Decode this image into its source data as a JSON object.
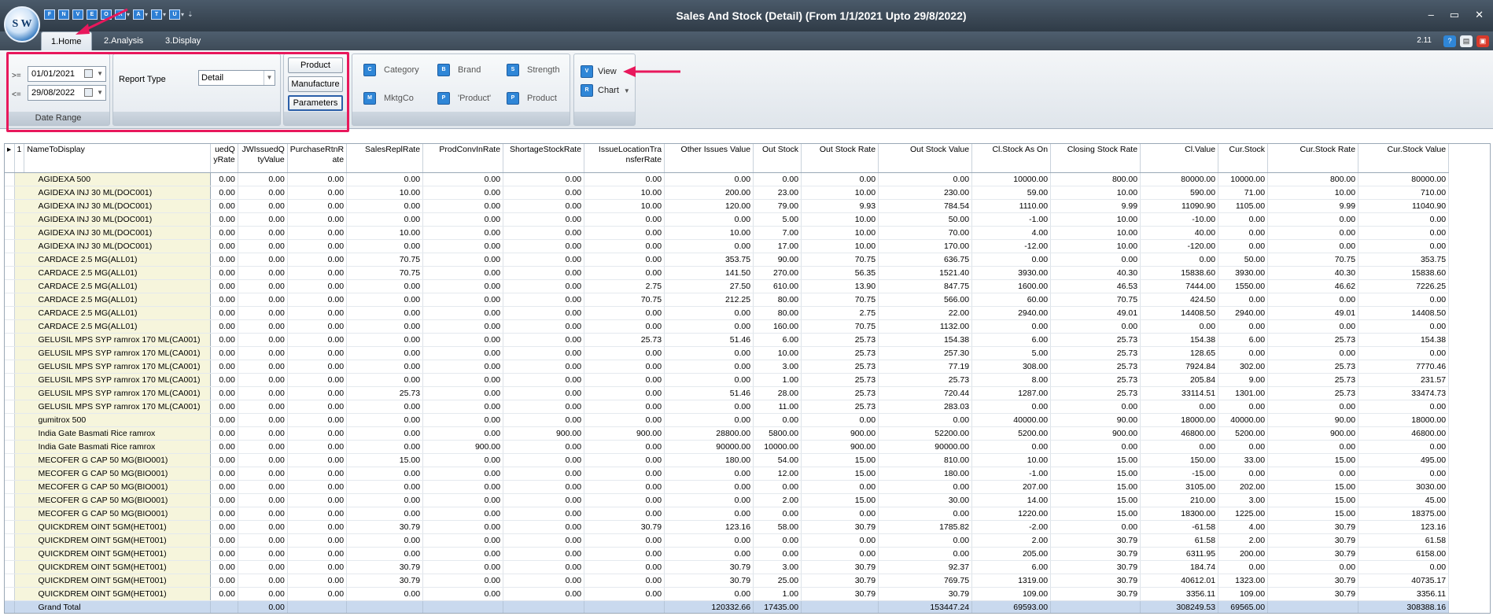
{
  "window": {
    "title": "Sales And Stock (Detail)  (From 1/1/2021 Upto 29/8/2022)",
    "logo_text": "S W",
    "version": "2.11"
  },
  "qat_buttons": [
    "F",
    "N",
    "V",
    "E",
    "O",
    "R",
    "A",
    "T",
    "U"
  ],
  "tabs": [
    {
      "label": "1.Home",
      "active": true
    },
    {
      "label": "2.Analysis",
      "active": false
    },
    {
      "label": "3.Display",
      "active": false
    }
  ],
  "ribbon": {
    "date_range": {
      "from_label": ">=",
      "from_value": "01/01/2021",
      "to_label": "<=",
      "to_value": "29/08/2022",
      "caption": "Date Range"
    },
    "report_type": {
      "label": "Report Type",
      "value": "Detail"
    },
    "buttons": {
      "product": "Product",
      "manufacture": "Manufacture",
      "parameters": "Parameters"
    },
    "filters": [
      {
        "label": "Category",
        "icon": "category-icon"
      },
      {
        "label": "Brand",
        "icon": "brand-icon"
      },
      {
        "label": "Strength",
        "icon": "strength-icon"
      },
      {
        "label": "MktgCo",
        "icon": "mktgco-icon"
      },
      {
        "label": "'Product'",
        "icon": "product-filter-icon"
      },
      {
        "label": "Product",
        "icon": "product-icon"
      }
    ],
    "view_label": "View",
    "chart_label": "Chart"
  },
  "grid": {
    "row_indicator": "1",
    "columns": [
      "NameToDisplay",
      "uedQ yRate",
      "JWIssuedQ tyValue",
      "PurchaseRtnR ate",
      "SalesReplRate",
      "ProdConvInRate",
      "ShortageStockRate",
      "IssueLocationTra nsferRate",
      "Other Issues Value",
      "Out Stock",
      "Out Stock Rate",
      "Out Stock Value",
      "Cl.Stock As On",
      "Closing Stock Rate",
      "Cl.Value",
      "Cur.Stock",
      "Cur.Stock Rate",
      "Cur.Stock Value"
    ],
    "rows": [
      [
        "AGIDEXA 500",
        "0.00",
        "0.00",
        "0.00",
        "0.00",
        "0.00",
        "0.00",
        "0.00",
        "0.00",
        "0.00",
        "0.00",
        "0.00",
        "10000.00",
        "800.00",
        "80000.00",
        "10000.00",
        "800.00",
        "80000.00"
      ],
      [
        "AGIDEXA INJ 30 ML(DOC001)",
        "0.00",
        "0.00",
        "0.00",
        "10.00",
        "0.00",
        "0.00",
        "10.00",
        "200.00",
        "23.00",
        "10.00",
        "230.00",
        "59.00",
        "10.00",
        "590.00",
        "71.00",
        "10.00",
        "710.00"
      ],
      [
        "AGIDEXA INJ 30 ML(DOC001)",
        "0.00",
        "0.00",
        "0.00",
        "0.00",
        "0.00",
        "0.00",
        "10.00",
        "120.00",
        "79.00",
        "9.93",
        "784.54",
        "1110.00",
        "9.99",
        "11090.90",
        "1105.00",
        "9.99",
        "11040.90"
      ],
      [
        "AGIDEXA INJ 30 ML(DOC001)",
        "0.00",
        "0.00",
        "0.00",
        "0.00",
        "0.00",
        "0.00",
        "0.00",
        "0.00",
        "5.00",
        "10.00",
        "50.00",
        "-1.00",
        "10.00",
        "-10.00",
        "0.00",
        "0.00",
        "0.00"
      ],
      [
        "AGIDEXA INJ 30 ML(DOC001)",
        "0.00",
        "0.00",
        "0.00",
        "10.00",
        "0.00",
        "0.00",
        "0.00",
        "10.00",
        "7.00",
        "10.00",
        "70.00",
        "4.00",
        "10.00",
        "40.00",
        "0.00",
        "0.00",
        "0.00"
      ],
      [
        "AGIDEXA INJ 30 ML(DOC001)",
        "0.00",
        "0.00",
        "0.00",
        "0.00",
        "0.00",
        "0.00",
        "0.00",
        "0.00",
        "17.00",
        "10.00",
        "170.00",
        "-12.00",
        "10.00",
        "-120.00",
        "0.00",
        "0.00",
        "0.00"
      ],
      [
        "CARDACE 2.5 MG(ALL01)",
        "0.00",
        "0.00",
        "0.00",
        "70.75",
        "0.00",
        "0.00",
        "0.00",
        "353.75",
        "90.00",
        "70.75",
        "636.75",
        "0.00",
        "0.00",
        "0.00",
        "50.00",
        "70.75",
        "353.75"
      ],
      [
        "CARDACE 2.5 MG(ALL01)",
        "0.00",
        "0.00",
        "0.00",
        "70.75",
        "0.00",
        "0.00",
        "0.00",
        "141.50",
        "270.00",
        "56.35",
        "1521.40",
        "3930.00",
        "40.30",
        "15838.60",
        "3930.00",
        "40.30",
        "15838.60"
      ],
      [
        "CARDACE 2.5 MG(ALL01)",
        "0.00",
        "0.00",
        "0.00",
        "0.00",
        "0.00",
        "0.00",
        "2.75",
        "27.50",
        "610.00",
        "13.90",
        "847.75",
        "1600.00",
        "46.53",
        "7444.00",
        "1550.00",
        "46.62",
        "7226.25"
      ],
      [
        "CARDACE 2.5 MG(ALL01)",
        "0.00",
        "0.00",
        "0.00",
        "0.00",
        "0.00",
        "0.00",
        "70.75",
        "212.25",
        "80.00",
        "70.75",
        "566.00",
        "60.00",
        "70.75",
        "424.50",
        "0.00",
        "0.00",
        "0.00"
      ],
      [
        "CARDACE 2.5 MG(ALL01)",
        "0.00",
        "0.00",
        "0.00",
        "0.00",
        "0.00",
        "0.00",
        "0.00",
        "0.00",
        "80.00",
        "2.75",
        "22.00",
        "2940.00",
        "49.01",
        "14408.50",
        "2940.00",
        "49.01",
        "14408.50"
      ],
      [
        "CARDACE 2.5 MG(ALL01)",
        "0.00",
        "0.00",
        "0.00",
        "0.00",
        "0.00",
        "0.00",
        "0.00",
        "0.00",
        "160.00",
        "70.75",
        "1132.00",
        "0.00",
        "0.00",
        "0.00",
        "0.00",
        "0.00",
        "0.00"
      ],
      [
        "GELUSIL MPS SYP ramrox 170 ML(CA001)",
        "0.00",
        "0.00",
        "0.00",
        "0.00",
        "0.00",
        "0.00",
        "25.73",
        "51.46",
        "6.00",
        "25.73",
        "154.38",
        "6.00",
        "25.73",
        "154.38",
        "6.00",
        "25.73",
        "154.38"
      ],
      [
        "GELUSIL MPS SYP ramrox 170 ML(CA001)",
        "0.00",
        "0.00",
        "0.00",
        "0.00",
        "0.00",
        "0.00",
        "0.00",
        "0.00",
        "10.00",
        "25.73",
        "257.30",
        "5.00",
        "25.73",
        "128.65",
        "0.00",
        "0.00",
        "0.00"
      ],
      [
        "GELUSIL MPS SYP ramrox 170 ML(CA001)",
        "0.00",
        "0.00",
        "0.00",
        "0.00",
        "0.00",
        "0.00",
        "0.00",
        "0.00",
        "3.00",
        "25.73",
        "77.19",
        "308.00",
        "25.73",
        "7924.84",
        "302.00",
        "25.73",
        "7770.46"
      ],
      [
        "GELUSIL MPS SYP ramrox 170 ML(CA001)",
        "0.00",
        "0.00",
        "0.00",
        "0.00",
        "0.00",
        "0.00",
        "0.00",
        "0.00",
        "1.00",
        "25.73",
        "25.73",
        "8.00",
        "25.73",
        "205.84",
        "9.00",
        "25.73",
        "231.57"
      ],
      [
        "GELUSIL MPS SYP ramrox 170 ML(CA001)",
        "0.00",
        "0.00",
        "0.00",
        "25.73",
        "0.00",
        "0.00",
        "0.00",
        "51.46",
        "28.00",
        "25.73",
        "720.44",
        "1287.00",
        "25.73",
        "33114.51",
        "1301.00",
        "25.73",
        "33474.73"
      ],
      [
        "GELUSIL MPS SYP ramrox 170 ML(CA001)",
        "0.00",
        "0.00",
        "0.00",
        "0.00",
        "0.00",
        "0.00",
        "0.00",
        "0.00",
        "11.00",
        "25.73",
        "283.03",
        "0.00",
        "0.00",
        "0.00",
        "0.00",
        "0.00",
        "0.00"
      ],
      [
        "gumitrox 500",
        "0.00",
        "0.00",
        "0.00",
        "0.00",
        "0.00",
        "0.00",
        "0.00",
        "0.00",
        "0.00",
        "0.00",
        "0.00",
        "40000.00",
        "90.00",
        "18000.00",
        "40000.00",
        "90.00",
        "18000.00"
      ],
      [
        "India Gate Basmati Rice ramrox",
        "0.00",
        "0.00",
        "0.00",
        "0.00",
        "0.00",
        "900.00",
        "900.00",
        "28800.00",
        "5800.00",
        "900.00",
        "52200.00",
        "5200.00",
        "900.00",
        "46800.00",
        "5200.00",
        "900.00",
        "46800.00"
      ],
      [
        "India Gate Basmati Rice ramrox",
        "0.00",
        "0.00",
        "0.00",
        "0.00",
        "900.00",
        "0.00",
        "0.00",
        "90000.00",
        "10000.00",
        "900.00",
        "90000.00",
        "0.00",
        "0.00",
        "0.00",
        "0.00",
        "0.00",
        "0.00"
      ],
      [
        "MECOFER G CAP 50 MG(BIO001)",
        "0.00",
        "0.00",
        "0.00",
        "15.00",
        "0.00",
        "0.00",
        "0.00",
        "180.00",
        "54.00",
        "15.00",
        "810.00",
        "10.00",
        "15.00",
        "150.00",
        "33.00",
        "15.00",
        "495.00"
      ],
      [
        "MECOFER G CAP 50 MG(BIO001)",
        "0.00",
        "0.00",
        "0.00",
        "0.00",
        "0.00",
        "0.00",
        "0.00",
        "0.00",
        "12.00",
        "15.00",
        "180.00",
        "-1.00",
        "15.00",
        "-15.00",
        "0.00",
        "0.00",
        "0.00"
      ],
      [
        "MECOFER G CAP 50 MG(BIO001)",
        "0.00",
        "0.00",
        "0.00",
        "0.00",
        "0.00",
        "0.00",
        "0.00",
        "0.00",
        "0.00",
        "0.00",
        "0.00",
        "207.00",
        "15.00",
        "3105.00",
        "202.00",
        "15.00",
        "3030.00"
      ],
      [
        "MECOFER G CAP 50 MG(BIO001)",
        "0.00",
        "0.00",
        "0.00",
        "0.00",
        "0.00",
        "0.00",
        "0.00",
        "0.00",
        "2.00",
        "15.00",
        "30.00",
        "14.00",
        "15.00",
        "210.00",
        "3.00",
        "15.00",
        "45.00"
      ],
      [
        "MECOFER G CAP 50 MG(BIO001)",
        "0.00",
        "0.00",
        "0.00",
        "0.00",
        "0.00",
        "0.00",
        "0.00",
        "0.00",
        "0.00",
        "0.00",
        "0.00",
        "1220.00",
        "15.00",
        "18300.00",
        "1225.00",
        "15.00",
        "18375.00"
      ],
      [
        "QUICKDREM OINT 5GM(HET001)",
        "0.00",
        "0.00",
        "0.00",
        "30.79",
        "0.00",
        "0.00",
        "30.79",
        "123.16",
        "58.00",
        "30.79",
        "1785.82",
        "-2.00",
        "0.00",
        "-61.58",
        "4.00",
        "30.79",
        "123.16"
      ],
      [
        "QUICKDREM OINT 5GM(HET001)",
        "0.00",
        "0.00",
        "0.00",
        "0.00",
        "0.00",
        "0.00",
        "0.00",
        "0.00",
        "0.00",
        "0.00",
        "0.00",
        "2.00",
        "30.79",
        "61.58",
        "2.00",
        "30.79",
        "61.58"
      ],
      [
        "QUICKDREM OINT 5GM(HET001)",
        "0.00",
        "0.00",
        "0.00",
        "0.00",
        "0.00",
        "0.00",
        "0.00",
        "0.00",
        "0.00",
        "0.00",
        "0.00",
        "205.00",
        "30.79",
        "6311.95",
        "200.00",
        "30.79",
        "6158.00"
      ],
      [
        "QUICKDREM OINT 5GM(HET001)",
        "0.00",
        "0.00",
        "0.00",
        "30.79",
        "0.00",
        "0.00",
        "0.00",
        "30.79",
        "3.00",
        "30.79",
        "92.37",
        "6.00",
        "30.79",
        "184.74",
        "0.00",
        "0.00",
        "0.00"
      ],
      [
        "QUICKDREM OINT 5GM(HET001)",
        "0.00",
        "0.00",
        "0.00",
        "30.79",
        "0.00",
        "0.00",
        "0.00",
        "30.79",
        "25.00",
        "30.79",
        "769.75",
        "1319.00",
        "30.79",
        "40612.01",
        "1323.00",
        "30.79",
        "40735.17"
      ],
      [
        "QUICKDREM OINT 5GM(HET001)",
        "0.00",
        "0.00",
        "0.00",
        "0.00",
        "0.00",
        "0.00",
        "0.00",
        "0.00",
        "1.00",
        "30.79",
        "30.79",
        "109.00",
        "30.79",
        "3356.11",
        "109.00",
        "30.79",
        "3356.11"
      ]
    ],
    "total": [
      "Grand Total",
      "",
      "0.00",
      "",
      "",
      "",
      "",
      "",
      "120332.66",
      "17435.00",
      "",
      "153447.24",
      "69593.00",
      "",
      "308249.53",
      "69565.00",
      "",
      "308388.16"
    ]
  },
  "colors": {
    "title_bar": "#3a4754",
    "name_column": "#f6f5dc",
    "total_row": "#c9d9ee",
    "highlight": "#e8185c"
  }
}
